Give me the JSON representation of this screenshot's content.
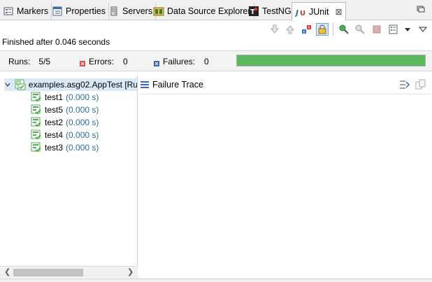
{
  "tabs": [
    {
      "label": "Markers",
      "icon": "markers-icon"
    },
    {
      "label": "Properties",
      "icon": "properties-icon"
    },
    {
      "label": "Servers",
      "icon": "servers-icon"
    },
    {
      "label": "Data Source Explorer",
      "icon": "data-source-explorer-icon"
    },
    {
      "label": "TestNG",
      "icon": "testng-icon"
    },
    {
      "label": "JUnit",
      "icon": "junit-icon",
      "active": true,
      "close": "⊠"
    }
  ],
  "status_text": "Finished after 0.046 seconds",
  "counters": {
    "runs_label": "Runs:",
    "runs_value": "5/5",
    "errors_label": "Errors:",
    "errors_value": "0",
    "failures_label": "Failures:",
    "failures_value": "0",
    "progress": 1.0,
    "progress_color": "#5cb85c"
  },
  "tree": {
    "root_label": "examples.asg02.AppTest [Ru",
    "tests": [
      {
        "name": "test1",
        "time": "(0.000 s)"
      },
      {
        "name": "test5",
        "time": "(0.000 s)"
      },
      {
        "name": "test2",
        "time": "(0.000 s)"
      },
      {
        "name": "test4",
        "time": "(0.000 s)"
      },
      {
        "name": "test3",
        "time": "(0.000 s)"
      }
    ]
  },
  "trace": {
    "title": "Failure Trace"
  },
  "colors": {
    "accent": "#2d6c9f",
    "selection": "#dbe8f6",
    "success": "#5cb85c",
    "error": "#d9534f"
  }
}
